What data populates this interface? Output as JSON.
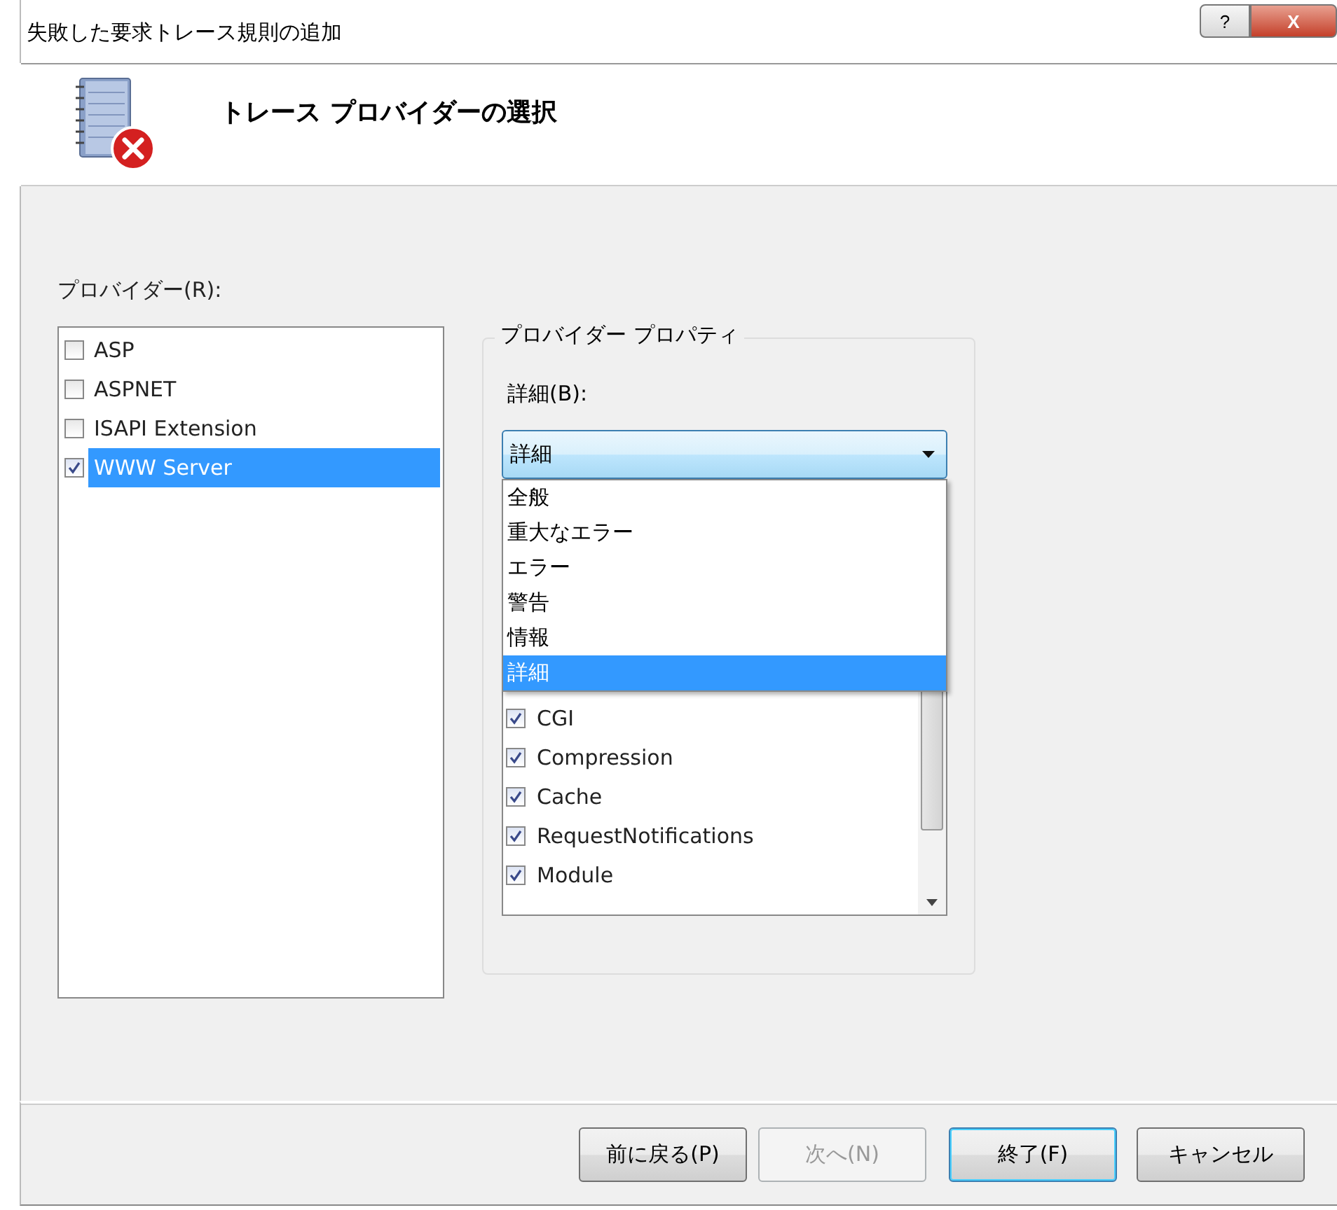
{
  "window": {
    "title": "失敗した要求トレース規則の追加"
  },
  "title_buttons": [
    {
      "label": "?",
      "kind": "help"
    },
    {
      "label": "X",
      "kind": "close"
    }
  ],
  "header": {
    "title": "トレース プロバイダーの選択"
  },
  "providers": {
    "label": "プロバイダー(R):",
    "items": [
      {
        "label": "ASP",
        "checked": false,
        "selected": false
      },
      {
        "label": "ASPNET",
        "checked": false,
        "selected": false
      },
      {
        "label": "ISAPI Extension",
        "checked": false,
        "selected": false
      },
      {
        "label": "WWW Server",
        "checked": true,
        "selected": true
      }
    ]
  },
  "properties": {
    "title": "プロバイダー プロパティ",
    "verbosity_label": "詳細(B):",
    "verbosity_value": "詳細",
    "dropdown_options": [
      {
        "label": "全般",
        "selected": false
      },
      {
        "label": "重大なエラー",
        "selected": false
      },
      {
        "label": "エラー",
        "selected": false
      },
      {
        "label": "警告",
        "selected": false
      },
      {
        "label": "情報",
        "selected": false
      },
      {
        "label": "詳細",
        "selected": true
      }
    ],
    "areas": [
      {
        "label": "CGI",
        "checked": true
      },
      {
        "label": "Compression",
        "checked": true
      },
      {
        "label": "Cache",
        "checked": true
      },
      {
        "label": "RequestNotifications",
        "checked": true
      },
      {
        "label": "Module",
        "checked": true
      }
    ]
  },
  "buttons": [
    {
      "label": "前に戻る(P)",
      "disabled": false,
      "default": false
    },
    {
      "label": "次へ(N)",
      "disabled": true,
      "default": false
    },
    {
      "label": "終了(F)",
      "disabled": false,
      "default": true
    },
    {
      "label": "キャンセル",
      "disabled": false,
      "default": false
    }
  ]
}
